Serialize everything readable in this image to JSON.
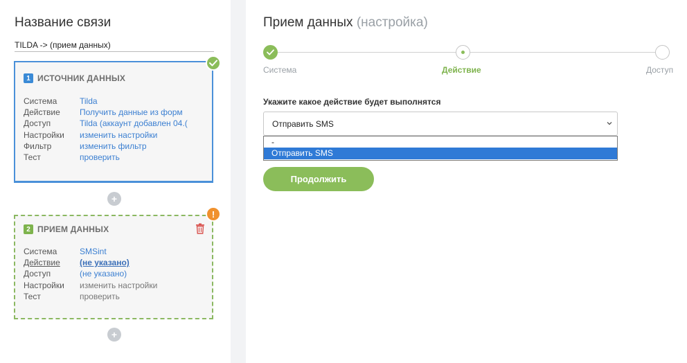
{
  "connection": {
    "title": "Название связи",
    "name": "TILDA -> (прием данных)"
  },
  "source_card": {
    "number": "1",
    "title": "ИСТОЧНИК ДАННЫХ",
    "rows": [
      {
        "key": "Система",
        "value": "Tilda"
      },
      {
        "key": "Действие",
        "value": "Получить данные из форм"
      },
      {
        "key": "Доступ",
        "value": "Tilda (аккаунт добавлен 04.("
      },
      {
        "key": "Настройки",
        "value": "изменить настройки"
      },
      {
        "key": "Фильтр",
        "value": "изменить фильтр"
      },
      {
        "key": "Тест",
        "value": "проверить"
      }
    ]
  },
  "receive_card": {
    "number": "2",
    "title": "ПРИЕМ ДАННЫХ",
    "rows": [
      {
        "key": "Система",
        "value": "SMSint"
      },
      {
        "key": "Действие",
        "value": "(не указано)"
      },
      {
        "key": "Доступ",
        "value": "(не указано)"
      },
      {
        "key": "Настройки",
        "value": "изменить настройки"
      },
      {
        "key": "Тест",
        "value": "проверить"
      }
    ]
  },
  "status": {
    "warning_glyph": "!",
    "plus_glyph": "+"
  },
  "main": {
    "title": "Прием данных",
    "subtitle": "(настройка)",
    "steps": [
      {
        "label": "Система",
        "state": "done"
      },
      {
        "label": "Действие",
        "state": "active"
      },
      {
        "label": "Доступ",
        "state": "pending"
      }
    ],
    "field_label": "Укажите какое действие будет выполнятся",
    "select_value": "Отправить SMS",
    "options": [
      "-",
      "Отправить SMS"
    ],
    "continue_label": "Продолжить"
  },
  "colors": {
    "accent_green": "#8bbd5a",
    "accent_blue": "#3a8ad6",
    "warning_orange": "#f0912d",
    "link_blue": "#3b7fd1"
  }
}
